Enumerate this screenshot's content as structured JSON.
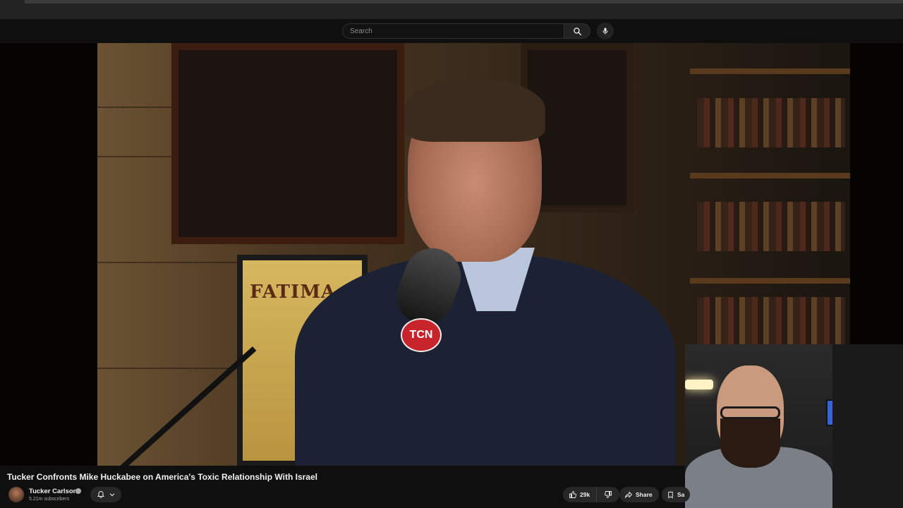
{
  "search": {
    "placeholder": "Search"
  },
  "video": {
    "title": "Tucker Confronts Mike Huckabee on America's Toxic Relationship With Israel",
    "poster_text": "FATIMA",
    "mic_logo": "TCN"
  },
  "channel": {
    "name": "Tucker Carlson",
    "subscribers": "5.21m subscribers"
  },
  "actions": {
    "like_count": "29k",
    "share_label": "Share",
    "save_label": "Sa"
  },
  "icons": {
    "search": "search-icon",
    "mic": "microphone-icon",
    "bell": "bell-icon",
    "chevron": "chevron-down-icon",
    "like": "thumbs-up-icon",
    "dislike": "thumbs-down-icon",
    "share": "share-arrow-icon",
    "save": "bookmark-icon",
    "verified": "verified-badge-icon"
  }
}
